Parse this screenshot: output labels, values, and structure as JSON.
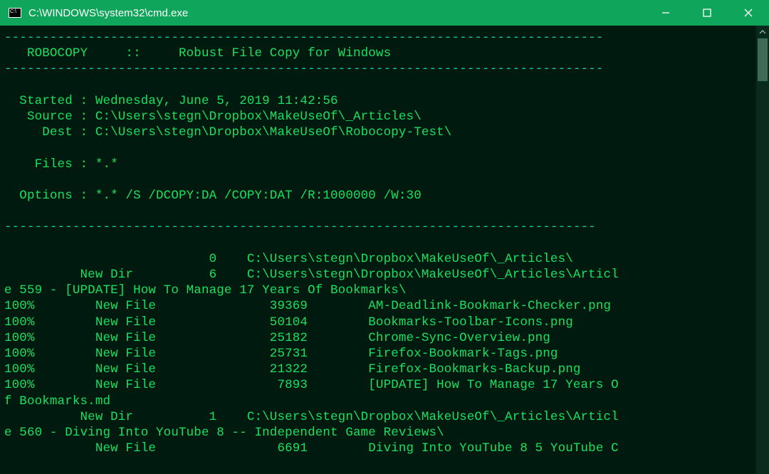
{
  "titlebar": {
    "title": "C:\\WINDOWS\\system32\\cmd.exe"
  },
  "sep1": "-------------------------------------------------------------------------------",
  "header": "   ROBOCOPY     ::     Robust File Copy for Windows",
  "sep2": "-------------------------------------------------------------------------------",
  "started": "  Started : Wednesday, June 5, 2019 11:42:56",
  "source": "   Source : C:\\Users\\stegn\\Dropbox\\MakeUseOf\\_Articles\\",
  "dest": "     Dest : C:\\Users\\stegn\\Dropbox\\MakeUseOf\\Robocopy-Test\\",
  "files": "    Files : *.*",
  "options": "  Options : *.* /S /DCOPY:DA /COPY:DAT /R:1000000 /W:30",
  "sep3": "------------------------------------------------------------------------------",
  "l1": "                           0    C:\\Users\\stegn\\Dropbox\\MakeUseOf\\_Articles\\",
  "l2": "          New Dir          6    C:\\Users\\stegn\\Dropbox\\MakeUseOf\\_Articles\\Articl",
  "l3": "e 559 - [UPDATE] How To Manage 17 Years Of Bookmarks\\",
  "l4": "100%        New File               39369        AM-Deadlink-Bookmark-Checker.png",
  "l5": "100%        New File               50104        Bookmarks-Toolbar-Icons.png",
  "l6": "100%        New File               25182        Chrome-Sync-Overview.png",
  "l7": "100%        New File               25731        Firefox-Bookmark-Tags.png",
  "l8": "100%        New File               21322        Firefox-Bookmarks-Backup.png",
  "l9": "100%        New File                7893        [UPDATE] How To Manage 17 Years O",
  "l10": "f Bookmarks.md",
  "l11": "          New Dir          1    C:\\Users\\stegn\\Dropbox\\MakeUseOf\\_Articles\\Articl",
  "l12": "e 560 - Diving Into YouTube 8 -- Independent Game Reviews\\",
  "l13": "            New File                6691        Diving Into YouTube 8 5 YouTube C"
}
